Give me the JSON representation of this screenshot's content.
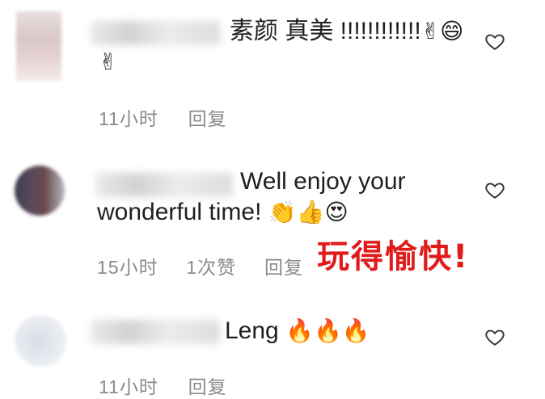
{
  "comments": [
    {
      "text": "素颜 真美 !!!!!!!!!!!!",
      "emoji_inline": "✌😄",
      "emoji_line2": "✌",
      "time": "11小时",
      "reply": "回复"
    },
    {
      "text_line1": "Well enjoy your",
      "text_line2": "wonderful time!",
      "emojis": "👏👍😍",
      "time": "15小时",
      "likes": "1次赞",
      "reply": "回复"
    },
    {
      "text": "Leng",
      "emojis": "🔥🔥🔥",
      "time": "11小时",
      "reply": "回复"
    }
  ],
  "overlay_caption": "玩得愉快!",
  "icons": [
    "heart-icon",
    "avatar"
  ]
}
